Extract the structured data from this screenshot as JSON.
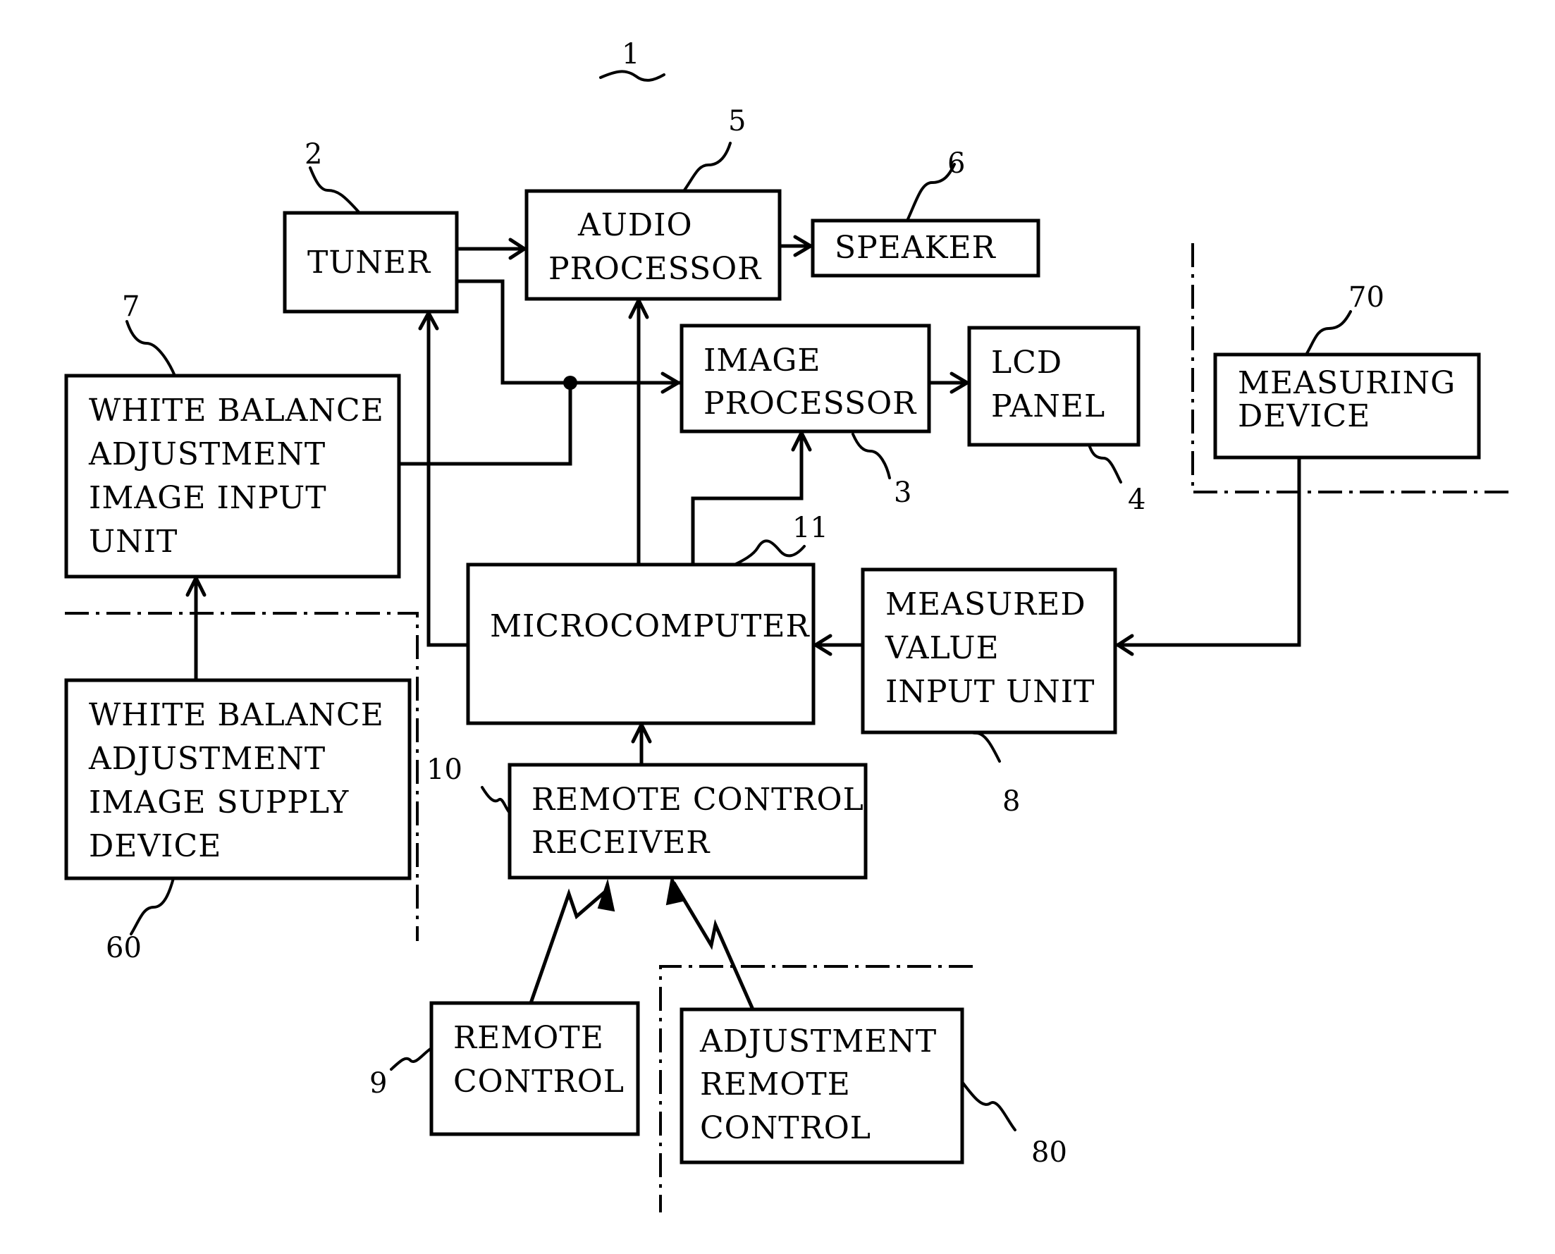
{
  "figure": {
    "ref_label": "1",
    "blocks": {
      "tuner": {
        "ref": "2",
        "lines": [
          "TUNER"
        ]
      },
      "image_processor": {
        "ref": "3",
        "lines": [
          "IMAGE",
          "PROCESSOR"
        ]
      },
      "lcd_panel": {
        "ref": "4",
        "lines": [
          "LCD",
          "PANEL"
        ]
      },
      "audio_processor": {
        "ref": "5",
        "lines": [
          "AUDIO",
          "PROCESSOR"
        ]
      },
      "speaker": {
        "ref": "6",
        "lines": [
          "SPEAKER"
        ]
      },
      "wb_input_unit": {
        "ref": "7",
        "lines": [
          "WHITE BALANCE",
          "ADJUSTMENT",
          "IMAGE INPUT",
          "UNIT"
        ]
      },
      "measured_value_input_unit": {
        "ref": "8",
        "lines": [
          "MEASURED",
          "VALUE",
          "INPUT UNIT"
        ]
      },
      "remote_control": {
        "ref": "9",
        "lines": [
          "REMOTE",
          "CONTROL"
        ]
      },
      "remote_control_receiver": {
        "ref": "10",
        "lines": [
          "REMOTE CONTROL",
          "RECEIVER"
        ]
      },
      "microcomputer": {
        "ref": "11",
        "lines": [
          "MICROCOMPUTER"
        ]
      },
      "wb_supply_device": {
        "ref": "60",
        "lines": [
          "WHITE BALANCE",
          "ADJUSTMENT",
          "IMAGE SUPPLY",
          "DEVICE"
        ]
      },
      "measuring_device": {
        "ref": "70",
        "lines": [
          "MEASURING",
          "DEVICE"
        ]
      },
      "adjustment_remote_control": {
        "ref": "80",
        "lines": [
          "ADJUSTMENT",
          "REMOTE",
          "CONTROL"
        ]
      }
    },
    "connections": [
      {
        "from": "tuner",
        "to": "audio_processor",
        "type": "signal"
      },
      {
        "from": "tuner",
        "to": "image_processor",
        "type": "signal"
      },
      {
        "from": "wb_input_unit",
        "to": "image_processor",
        "type": "signal"
      },
      {
        "from": "audio_processor",
        "to": "speaker",
        "type": "signal"
      },
      {
        "from": "image_processor",
        "to": "lcd_panel",
        "type": "signal"
      },
      {
        "from": "microcomputer",
        "to": "tuner",
        "type": "control"
      },
      {
        "from": "microcomputer",
        "to": "audio_processor",
        "type": "control"
      },
      {
        "from": "microcomputer",
        "to": "image_processor",
        "type": "control"
      },
      {
        "from": "measured_value_input_unit",
        "to": "microcomputer",
        "type": "signal"
      },
      {
        "from": "measuring_device",
        "to": "measured_value_input_unit",
        "type": "signal"
      },
      {
        "from": "remote_control_receiver",
        "to": "microcomputer",
        "type": "signal"
      },
      {
        "from": "wb_supply_device",
        "to": "wb_input_unit",
        "type": "signal"
      },
      {
        "from": "remote_control",
        "to": "remote_control_receiver",
        "type": "wireless"
      },
      {
        "from": "adjustment_remote_control",
        "to": "remote_control_receiver",
        "type": "wireless"
      }
    ]
  }
}
